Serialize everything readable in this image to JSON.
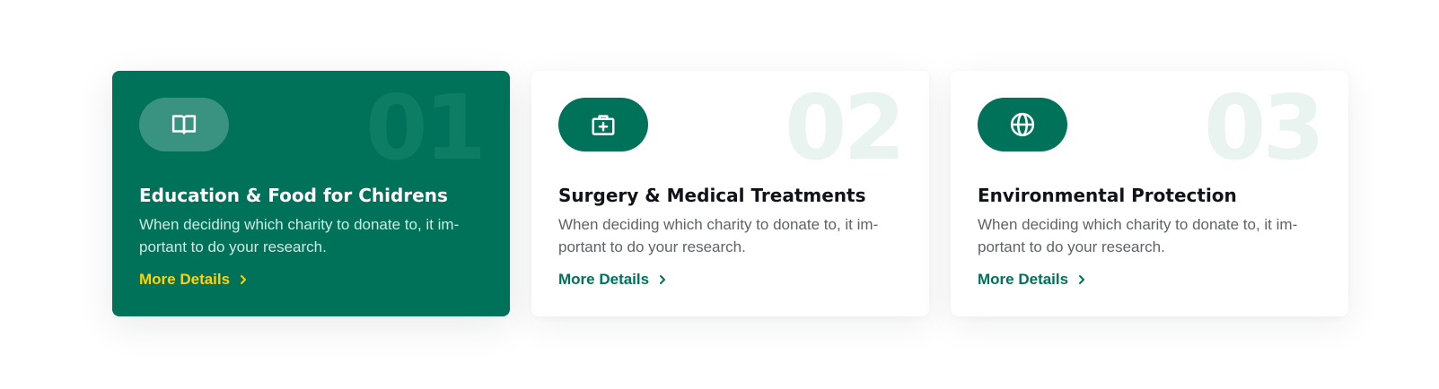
{
  "colors": {
    "primary": "#00725a",
    "accent": "#ffd200",
    "number_light": "#e9f3f0",
    "text_dark": "#101418",
    "text_muted": "#5f6368"
  },
  "cards": [
    {
      "number": "01",
      "icon": "book-icon",
      "title": "Education & Food for Chidrens",
      "description": "When deciding which charity to donate to, it im­portant to do your research.",
      "link_label": "More Details",
      "active": true
    },
    {
      "number": "02",
      "icon": "medical-kit-icon",
      "title": "Surgery & Medical Treatments",
      "description": "When deciding which charity to donate to, it im­portant to do your research.",
      "link_label": "More Details",
      "active": false
    },
    {
      "number": "03",
      "icon": "globe-icon",
      "title": "Environmental Protection",
      "description": "When deciding which charity to donate to, it im­portant to do your research.",
      "link_label": "More Details",
      "active": false
    }
  ]
}
